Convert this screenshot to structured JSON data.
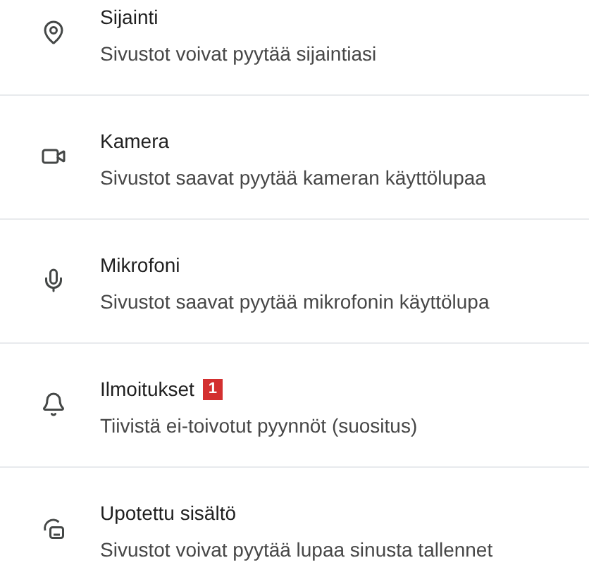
{
  "rows": [
    {
      "kind": "location",
      "title": "Sijainti",
      "subtitle": "Sivustot voivat pyytää sijaintiasi"
    },
    {
      "kind": "camera",
      "title": "Kamera",
      "subtitle": "Sivustot saavat pyytää kameran käyttölupaa"
    },
    {
      "kind": "microphone",
      "title": "Mikrofoni",
      "subtitle": "Sivustot saavat pyytää mikrofonin käyttölupa"
    },
    {
      "kind": "notifications",
      "title": "Ilmoitukset",
      "badge": "1",
      "subtitle": "Tiivistä ei-toivotut pyynnöt (suositus)"
    },
    {
      "kind": "embedded",
      "title": "Upotettu sisältö",
      "subtitle": "Sivustot voivat pyytää lupaa sinusta tallennet"
    }
  ]
}
